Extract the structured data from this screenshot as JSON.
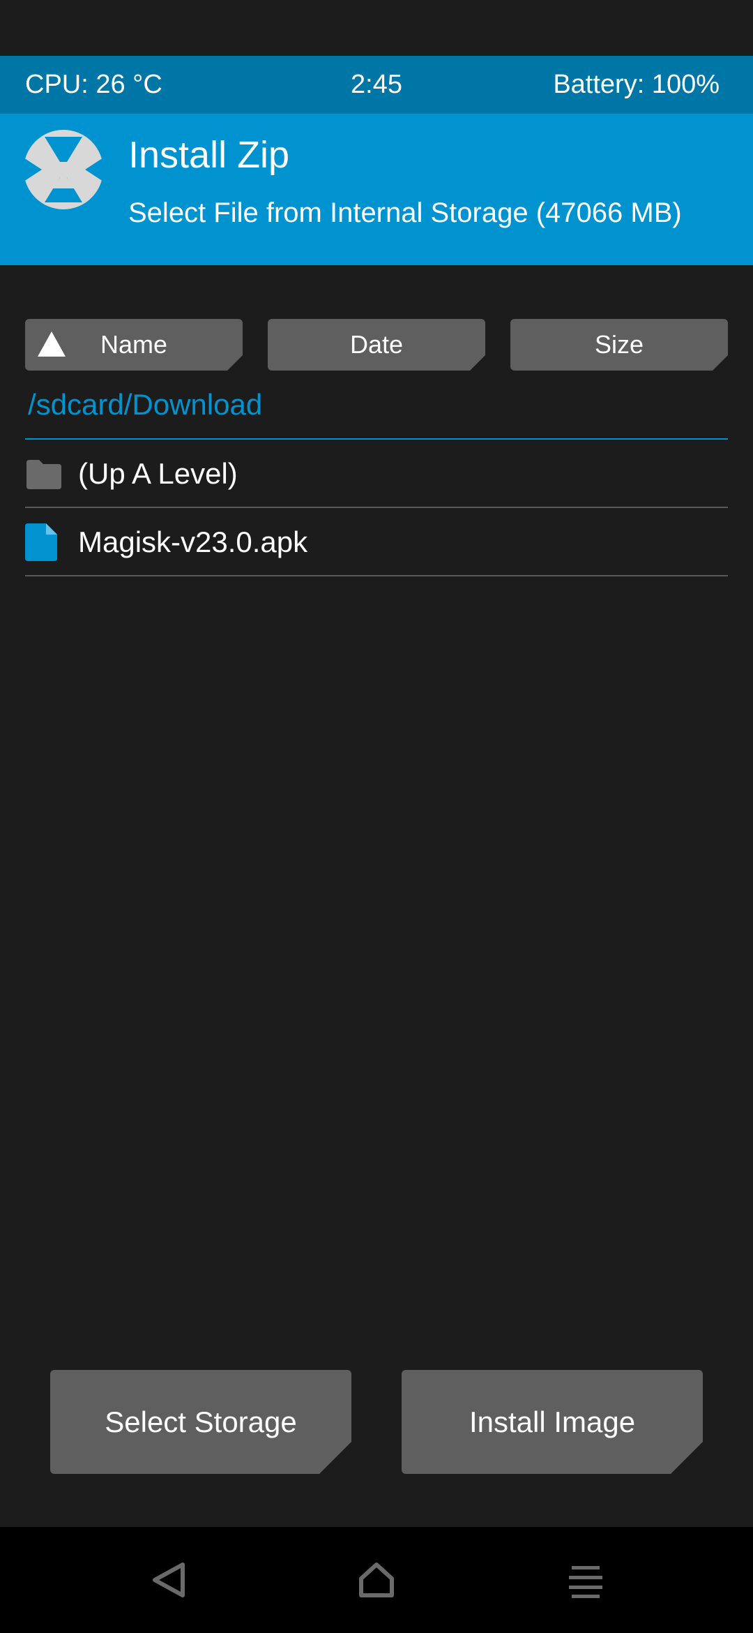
{
  "status_bar": {
    "cpu": "CPU: 26 °C",
    "time": "2:45",
    "battery": "Battery: 100%"
  },
  "header": {
    "logo_icon": "twrp-logo-icon",
    "title": "Install Zip",
    "subtitle": "Select File from Internal Storage (47066 MB)"
  },
  "sort": {
    "name_label": "Name",
    "date_label": "Date",
    "size_label": "Size",
    "active_sort": "Name",
    "sort_direction_icon": "sort-ascending-triangle-icon"
  },
  "path": "/sdcard/Download",
  "files": [
    {
      "icon": "folder-icon",
      "label": "(Up A Level)"
    },
    {
      "icon": "file-icon",
      "label": "Magisk-v23.0.apk"
    }
  ],
  "buttons": {
    "select_storage": "Select Storage",
    "install_image": "Install Image"
  },
  "nav": {
    "back_icon": "back-icon",
    "home_icon": "home-icon",
    "menu_icon": "menu-icon"
  },
  "colors": {
    "accent": "#0093d0",
    "status_bar": "#0076a6",
    "background": "#1c1c1c",
    "button": "#5f5f5f"
  }
}
